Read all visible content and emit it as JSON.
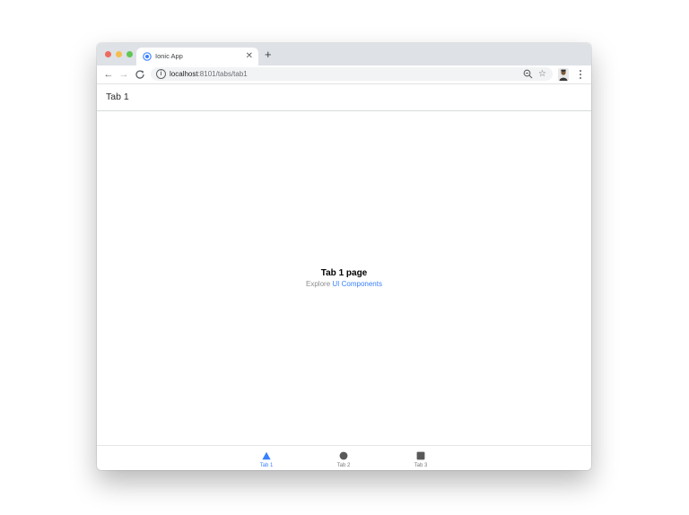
{
  "browser": {
    "tab_title": "Ionic App",
    "tab_close_glyph": "✕",
    "new_tab_glyph": "+",
    "url_host": "localhost",
    "url_path": ":8101/tabs/tab1",
    "back_glyph": "←",
    "forward_glyph": "→",
    "reload_glyph": "C",
    "star_glyph": "☆",
    "info_glyph": "i"
  },
  "app": {
    "header_title": "Tab 1"
  },
  "content": {
    "heading": "Tab 1 page",
    "explore_prefix": "Explore ",
    "explore_link": "UI Components"
  },
  "tabs": [
    {
      "label": "Tab 1",
      "icon": "triangle-icon",
      "selected": true
    },
    {
      "label": "Tab 2",
      "icon": "ellipse-icon",
      "selected": false
    },
    {
      "label": "Tab 3",
      "icon": "square-icon",
      "selected": false
    }
  ],
  "colors": {
    "accent": "#3880ff",
    "inactive_tab": "#7a7a7a",
    "tab_icon_inactive": "#595959",
    "traffic_close": "#ec6b5e",
    "traffic_min": "#f4be4f",
    "traffic_max": "#61c554"
  }
}
